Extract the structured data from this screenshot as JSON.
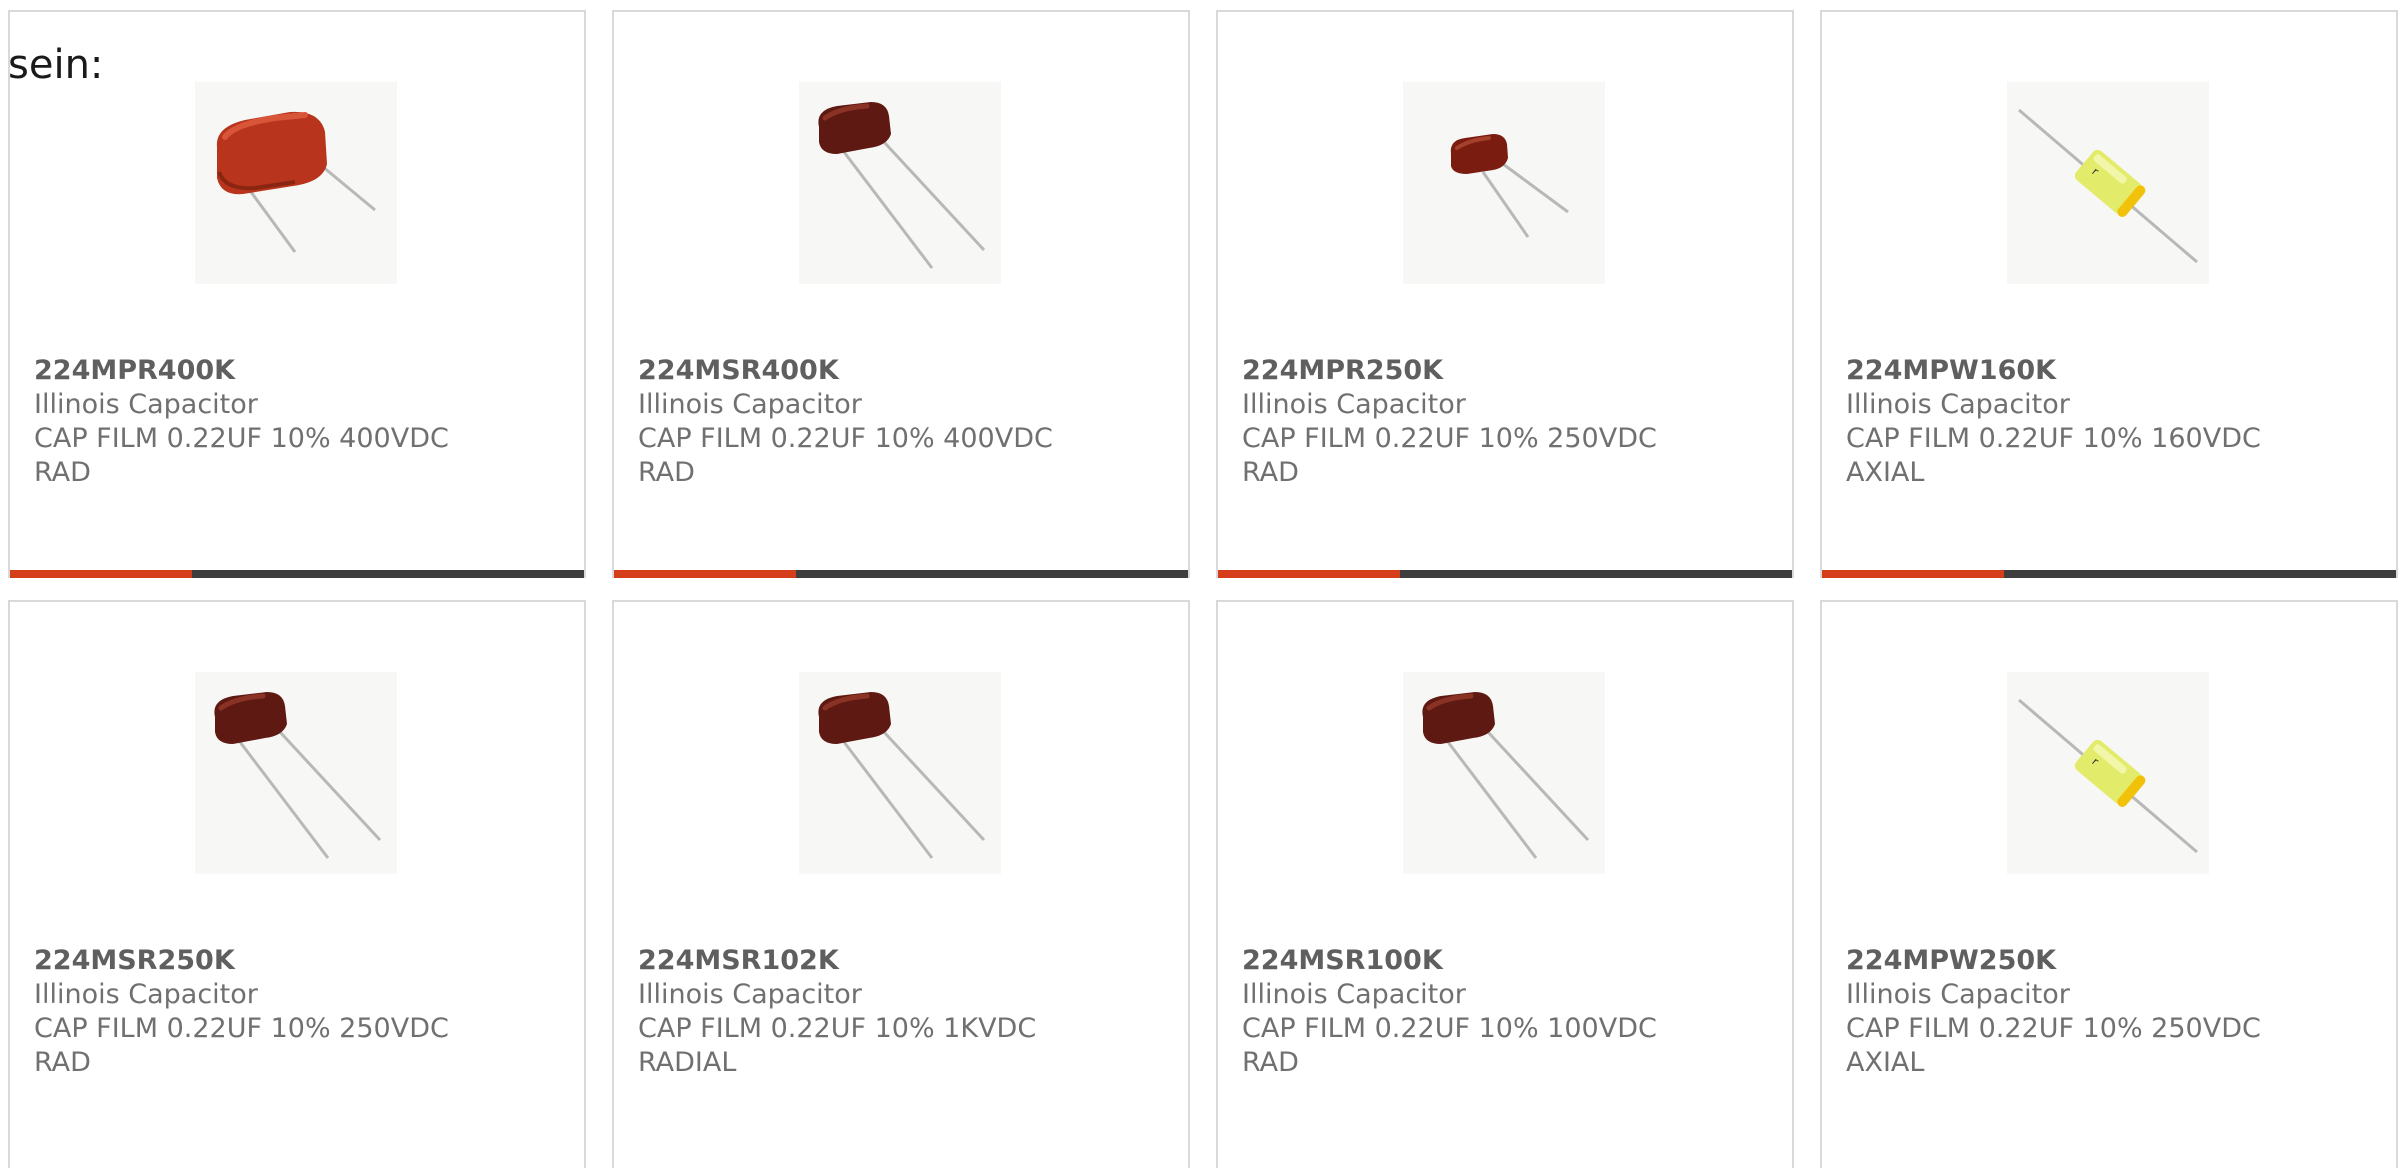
{
  "intro_text": "sein:",
  "colors": {
    "accent_bar": "#d63d1a",
    "dark_bar": "#3e3e3e",
    "card_border": "#d9d9d9",
    "text": "#707070"
  },
  "products": [
    {
      "part_number": "224MPR400K",
      "manufacturer": "Illinois Capacitor",
      "description": "CAP FILM 0.22UF 10% 400VDC",
      "package": "RAD",
      "image_icon": "radial-film-capacitor-wide-icon"
    },
    {
      "part_number": "224MSR400K",
      "manufacturer": "Illinois Capacitor",
      "description": "CAP FILM 0.22UF 10% 400VDC",
      "package": "RAD",
      "image_icon": "radial-film-capacitor-icon"
    },
    {
      "part_number": "224MPR250K",
      "manufacturer": "Illinois Capacitor",
      "description": "CAP FILM 0.22UF 10% 250VDC",
      "package": "RAD",
      "image_icon": "radial-film-capacitor-small-icon"
    },
    {
      "part_number": "224MPW160K",
      "manufacturer": "Illinois Capacitor",
      "description": "CAP FILM 0.22UF 10% 160VDC",
      "package": "AXIAL",
      "image_icon": "axial-film-capacitor-icon"
    },
    {
      "part_number": "224MSR250K",
      "manufacturer": "Illinois Capacitor",
      "description": "CAP FILM 0.22UF 10% 250VDC",
      "package": "RAD",
      "image_icon": "radial-film-capacitor-icon"
    },
    {
      "part_number": "224MSR102K",
      "manufacturer": "Illinois Capacitor",
      "description": "CAP FILM 0.22UF 10% 1KVDC",
      "package": "RADIAL",
      "image_icon": "radial-film-capacitor-icon"
    },
    {
      "part_number": "224MSR100K",
      "manufacturer": "Illinois Capacitor",
      "description": "CAP FILM 0.22UF 10% 100VDC",
      "package": "RAD",
      "image_icon": "radial-film-capacitor-icon"
    },
    {
      "part_number": "224MPW250K",
      "manufacturer": "Illinois Capacitor",
      "description": "CAP FILM 0.22UF 10% 250VDC",
      "package": "AXIAL",
      "image_icon": "axial-film-capacitor-icon"
    }
  ]
}
